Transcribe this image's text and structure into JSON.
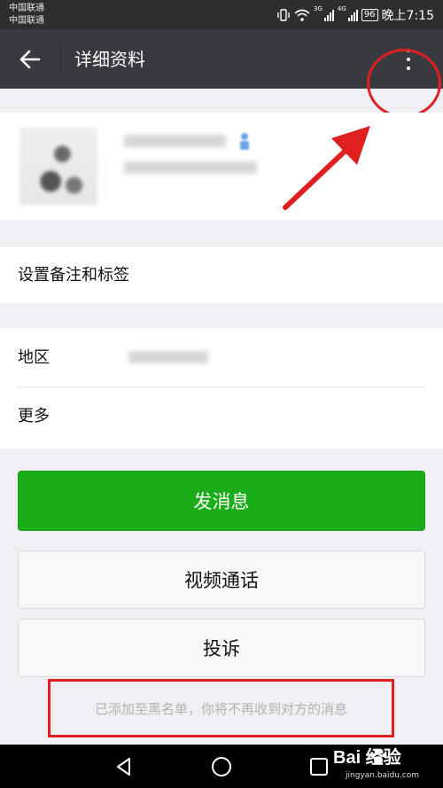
{
  "status_bar": {
    "carrier_1": "中国联通",
    "carrier_2": "中国联通",
    "network_1": "3G",
    "network_2": "4G",
    "battery": "96",
    "time": "晚上7:15"
  },
  "header": {
    "title": "详细资料",
    "back_icon": "arrow-left-icon",
    "more_icon": "vertical-ellipsis-icon"
  },
  "rows": {
    "remark_label": "设置备注和标签",
    "region_label": "地区",
    "more_label": "更多"
  },
  "buttons": {
    "send_message": "发消息",
    "video_call": "视频通话",
    "complain": "投诉"
  },
  "notice": "已添加至黑名单，你将不再收到对方的消息",
  "watermark": {
    "brand": "Bai  经验",
    "site": "jingyan.baidu.com"
  },
  "colors": {
    "title_bar": "#393a3f",
    "primary_button": "#1aad19",
    "annotation": "#e02020"
  }
}
